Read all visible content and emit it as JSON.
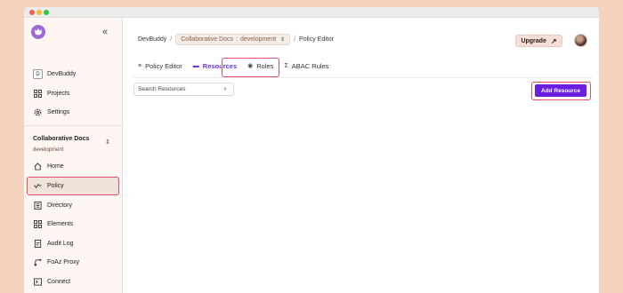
{
  "sidebar": {
    "collapse_icon": "«",
    "org": {
      "initial": "D",
      "name": "DevBuddy"
    },
    "top_items": [
      {
        "label": "Projects",
        "icon": "grid-icon"
      },
      {
        "label": "Settings",
        "icon": "gear-icon"
      }
    ],
    "project": {
      "name": "Collaborative Docs",
      "env": "development",
      "chevron": "⌃⌄"
    },
    "nav_items": [
      {
        "label": "Home",
        "icon": "home-icon"
      },
      {
        "label": "Policy",
        "icon": "policy-icon",
        "active": true
      },
      {
        "label": "Directory",
        "icon": "directory-icon"
      },
      {
        "label": "Elements",
        "icon": "grid-icon"
      },
      {
        "label": "Audit Log",
        "icon": "document-icon"
      },
      {
        "label": "FoAz Proxy",
        "icon": "proxy-icon"
      },
      {
        "label": "Connect",
        "icon": "terminal-icon"
      }
    ]
  },
  "breadcrumb": {
    "org": "DevBuddy",
    "sep": "/",
    "project": "Collaborative Docs",
    "env_sep": ":",
    "env": "development",
    "page": "Policy Editor"
  },
  "header": {
    "upgrade_label": "Upgrade",
    "upgrade_arrow": "↗"
  },
  "tabs": [
    {
      "label": "Policy Editor",
      "icon": "≡"
    },
    {
      "label": "Resources",
      "icon": "▬",
      "active": true
    },
    {
      "label": "Roles",
      "icon": "◉"
    },
    {
      "label": "ABAC Rules",
      "icon": "Σ"
    }
  ],
  "search": {
    "placeholder": "Search Resources",
    "icon": "⌕"
  },
  "actions": {
    "add_resource_label": "Add Resource"
  },
  "colors": {
    "accent": "#6a1fe0",
    "highlight": "#e64b6a",
    "background": "#f4d3be"
  }
}
